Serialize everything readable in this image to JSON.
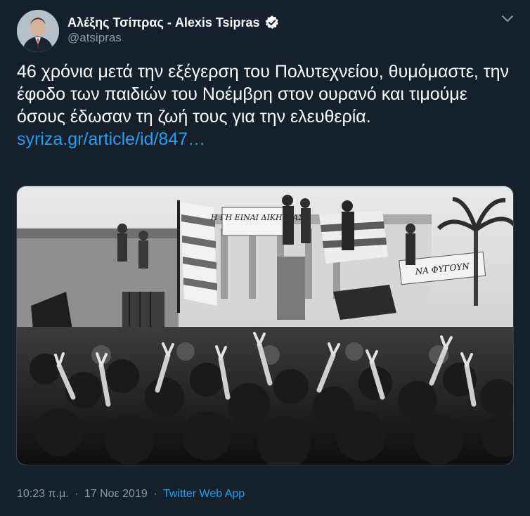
{
  "author": {
    "display_name": "Αλέξης Τσίπρας - Alexis Tsipras",
    "handle": "@atsipras",
    "verified": true
  },
  "tweet": {
    "text_main": "46 χρόνια μετά την εξέγερση του Πολυτεχνείου, θυμόμαστε, την έφοδο των παιδιών του Νοέμβρη στον ουρανό και τιμούμε όσους έδωσαν τη ζωή τους για την ελευθερία.",
    "link_text": "syriza.gr/article/id/847…"
  },
  "media": {
    "banner_left": "Η ΓΗ ΕΙΝΑΙ ΔΙΚΗ ΜΑΣ",
    "banner_right": "ΝΑ ΦΥΓΟΥΝ"
  },
  "meta": {
    "time": "10:23 π.μ.",
    "date": "17 Νοε 2019",
    "source": "Twitter Web App",
    "separator": "·"
  },
  "colors": {
    "background": "#15202b",
    "text": "#ffffff",
    "secondary": "#8899a6",
    "link": "#1da1f2"
  },
  "icons": {
    "verified": "verified-badge-icon",
    "more": "chevron-down-icon"
  }
}
